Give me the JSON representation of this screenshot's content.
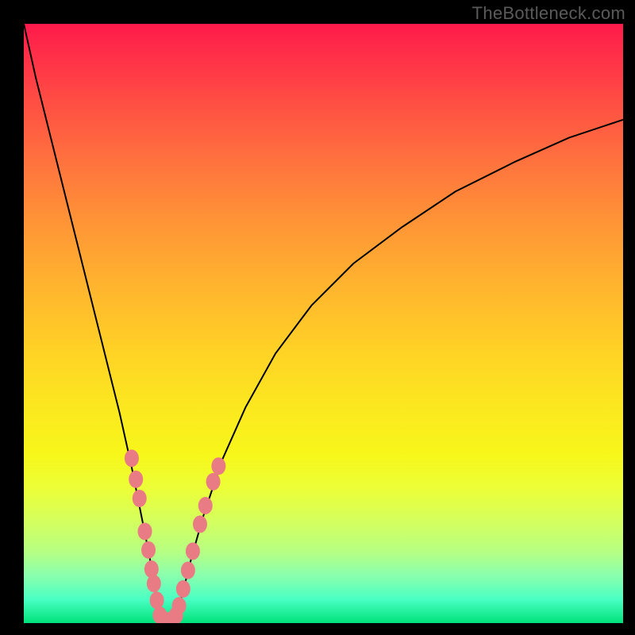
{
  "watermark": "TheBottleneck.com",
  "colors": {
    "frame": "#000000",
    "curve": "#000000",
    "dot_fill": "#e97b84",
    "dot_stroke": "#c85a63",
    "gradient_top": "#ff1a4b",
    "gradient_bottom": "#00e27a"
  },
  "chart_data": {
    "type": "line",
    "title": "",
    "xlabel": "",
    "ylabel": "",
    "xlim": [
      0,
      100
    ],
    "ylim": [
      0,
      100
    ],
    "grid": false,
    "legend": false,
    "series": [
      {
        "name": "left-branch",
        "x": [
          0,
          2,
          4,
          6,
          8,
          10,
          12,
          14,
          16,
          18,
          19,
          20,
          21,
          21.8,
          22.3,
          22.7
        ],
        "y": [
          100,
          91,
          83,
          75,
          67,
          59,
          51,
          43,
          35,
          26,
          21,
          16,
          11,
          6,
          3,
          1
        ]
      },
      {
        "name": "floor",
        "x": [
          22.7,
          23.0,
          23.5,
          24.0,
          24.5,
          25.0,
          25.4
        ],
        "y": [
          1,
          0.5,
          0.2,
          0.1,
          0.2,
          0.5,
          1
        ]
      },
      {
        "name": "right-branch",
        "x": [
          25.4,
          26,
          27,
          28,
          30,
          33,
          37,
          42,
          48,
          55,
          63,
          72,
          82,
          91,
          100
        ],
        "y": [
          1,
          3,
          7,
          11,
          18,
          27,
          36,
          45,
          53,
          60,
          66,
          72,
          77,
          81,
          84
        ]
      }
    ],
    "annotations": [
      {
        "name": "dots-left-branch",
        "points": [
          {
            "x": 18.0,
            "y": 27.5
          },
          {
            "x": 18.7,
            "y": 24.0
          },
          {
            "x": 19.3,
            "y": 20.8
          },
          {
            "x": 20.2,
            "y": 15.3
          },
          {
            "x": 20.8,
            "y": 12.2
          },
          {
            "x": 21.3,
            "y": 9.0
          },
          {
            "x": 21.7,
            "y": 6.6
          },
          {
            "x": 22.2,
            "y": 3.8
          }
        ]
      },
      {
        "name": "dots-floor",
        "points": [
          {
            "x": 22.7,
            "y": 1.3
          },
          {
            "x": 23.3,
            "y": 0.6
          },
          {
            "x": 24.1,
            "y": 0.3
          },
          {
            "x": 24.9,
            "y": 0.7
          },
          {
            "x": 25.4,
            "y": 1.3
          }
        ]
      },
      {
        "name": "dots-right-branch",
        "points": [
          {
            "x": 25.9,
            "y": 2.9
          },
          {
            "x": 26.6,
            "y": 5.7
          },
          {
            "x": 27.4,
            "y": 8.8
          },
          {
            "x": 28.2,
            "y": 12.0
          },
          {
            "x": 29.4,
            "y": 16.5
          },
          {
            "x": 30.3,
            "y": 19.6
          },
          {
            "x": 31.6,
            "y": 23.6
          },
          {
            "x": 32.5,
            "y": 26.2
          }
        ]
      }
    ]
  }
}
